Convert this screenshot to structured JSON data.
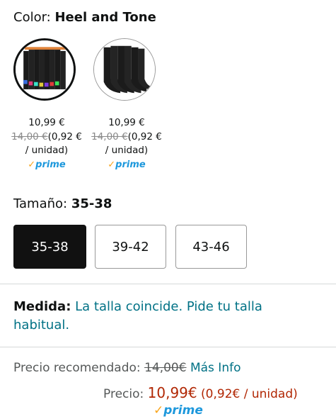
{
  "color": {
    "label": "Color:",
    "value": "Heel and Tone"
  },
  "swatches": [
    {
      "price": "10,99 €",
      "old_price": "14,00 €",
      "unit_price": "(0,92 €",
      "unit_suffix": "/ unidad)",
      "badge": "prime",
      "icon": "socks-colorful-heel-image",
      "selected": true
    },
    {
      "price": "10,99 €",
      "old_price": "14,00 €",
      "unit_price": "(0,92 €",
      "unit_suffix": "/ unidad)",
      "badge": "prime",
      "icon": "socks-black-image",
      "selected": false
    }
  ],
  "size": {
    "label": "Tamaño:",
    "selected": "35-38",
    "options": [
      "35-38",
      "39-42",
      "43-46"
    ]
  },
  "fit": {
    "label": "Medida:",
    "text": "La talla coincide. Pide tu talla habitual."
  },
  "pricing": {
    "rec_label": "Precio recomendado:",
    "rec_value": "14,00€",
    "more_info": "Más Info",
    "price_label": "Precio:",
    "price_value": "10,99€",
    "unit_value": "(0,92€ / unidad)",
    "badge": "prime"
  },
  "colors": {
    "link": "#007185",
    "price": "#B12704",
    "prime_blue": "#1D98DC",
    "prime_check": "#F8A51C"
  }
}
